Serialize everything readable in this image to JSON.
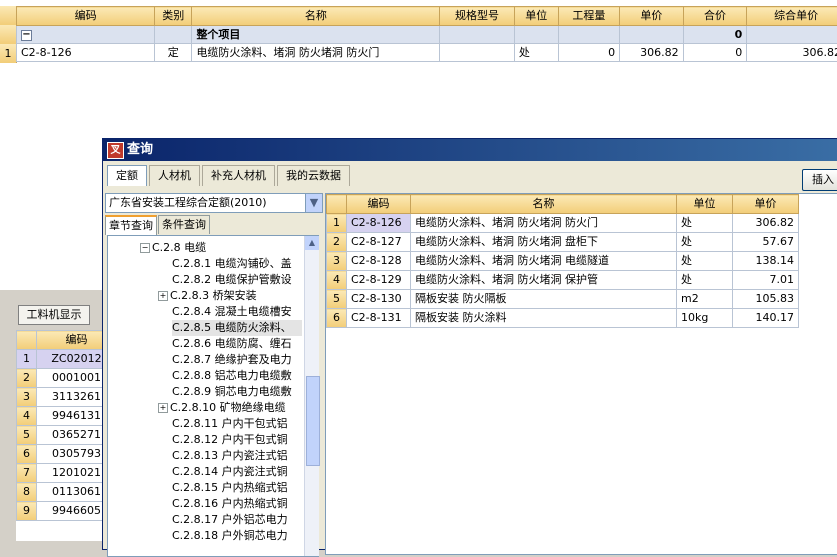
{
  "top_grid": {
    "columns": [
      "编码",
      "类别",
      "名称",
      "规格型号",
      "单位",
      "工程量",
      "单价",
      "合价",
      "综合单价"
    ],
    "summary": {
      "toggle": "−",
      "name": "整个项目",
      "total": "0"
    },
    "rows": [
      {
        "index": "1",
        "code": "C2-8-126",
        "type": "定",
        "name": "电缆防火涂料、堵洞 防火堵洞 防火门",
        "spec": "",
        "unit": "处",
        "qty": "0",
        "price": "306.82",
        "total": "0",
        "unit_total": "306.82"
      }
    ]
  },
  "lower_panel": {
    "tab_label": "工料机显示",
    "column": "编码",
    "rows": [
      {
        "index": "1",
        "code": "ZC02012"
      },
      {
        "index": "2",
        "code": "0001001"
      },
      {
        "index": "3",
        "code": "3113261"
      },
      {
        "index": "4",
        "code": "9946131"
      },
      {
        "index": "5",
        "code": "0365271"
      },
      {
        "index": "6",
        "code": "0305793"
      },
      {
        "index": "7",
        "code": "1201021"
      },
      {
        "index": "8",
        "code": "0113061"
      },
      {
        "index": "9",
        "code": "9946605"
      }
    ]
  },
  "dialog": {
    "title": "查询",
    "icon_glyph": "叉",
    "tabs": [
      "定额",
      "人材机",
      "补充人材机",
      "我的云数据"
    ],
    "insert_label": "插入",
    "quota_combo": "广东省安装工程综合定额(2010)",
    "subtabs": [
      "章节查询",
      "条件查询"
    ],
    "tree": [
      {
        "label": "C.2.8 电缆",
        "toggle": "−",
        "level": 0
      },
      {
        "label": "C.2.8.1 电缆沟铺砂、盖",
        "level": 1
      },
      {
        "label": "C.2.8.2 电缆保护管敷设",
        "level": 1
      },
      {
        "label": "C.2.8.3 桥架安装",
        "toggle": "+",
        "level": 1
      },
      {
        "label": "C.2.8.4 混凝土电缆槽安",
        "level": 1
      },
      {
        "label": "C.2.8.5 电缆防火涂料、",
        "level": 1,
        "selected": true
      },
      {
        "label": "C.2.8.6 电缆防腐、缠石",
        "level": 1
      },
      {
        "label": "C.2.8.7 绝缘护套及电力",
        "level": 1
      },
      {
        "label": "C.2.8.8 铝芯电力电缆敷",
        "level": 1
      },
      {
        "label": "C.2.8.9 铜芯电力电缆敷",
        "level": 1
      },
      {
        "label": "C.2.8.10 矿物绝缘电缆",
        "toggle": "+",
        "level": 1
      },
      {
        "label": "C.2.8.11 户内干包式铝",
        "level": 1
      },
      {
        "label": "C.2.8.12 户内干包式铜",
        "level": 1
      },
      {
        "label": "C.2.8.13 户内瓷注式铝",
        "level": 1
      },
      {
        "label": "C.2.8.14 户内瓷注式铜",
        "level": 1
      },
      {
        "label": "C.2.8.15 户内热缩式铝",
        "level": 1
      },
      {
        "label": "C.2.8.16 户内热缩式铜",
        "level": 1
      },
      {
        "label": "C.2.8.17 户外铝芯电力",
        "level": 1
      },
      {
        "label": "C.2.8.18 户外铜芯电力",
        "level": 1
      }
    ],
    "results": {
      "columns": [
        "编码",
        "名称",
        "单位",
        "单价"
      ],
      "rows": [
        {
          "index": "1",
          "code": "C2-8-126",
          "name": "电缆防火涂料、堵洞 防火堵洞 防火门",
          "unit": "处",
          "price": "306.82"
        },
        {
          "index": "2",
          "code": "C2-8-127",
          "name": "电缆防火涂料、堵洞 防火堵洞 盘柜下",
          "unit": "处",
          "price": "57.67"
        },
        {
          "index": "3",
          "code": "C2-8-128",
          "name": "电缆防火涂料、堵洞 防火堵洞 电缆隧道",
          "unit": "处",
          "price": "138.14"
        },
        {
          "index": "4",
          "code": "C2-8-129",
          "name": "电缆防火涂料、堵洞 防火堵洞 保护管",
          "unit": "处",
          "price": "7.01"
        },
        {
          "index": "5",
          "code": "C2-8-130",
          "name": "隔板安装 防火隔板",
          "unit": "m2",
          "price": "105.83"
        },
        {
          "index": "6",
          "code": "C2-8-131",
          "name": "隔板安装 防火涂料",
          "unit": "10kg",
          "price": "140.17"
        }
      ]
    }
  }
}
